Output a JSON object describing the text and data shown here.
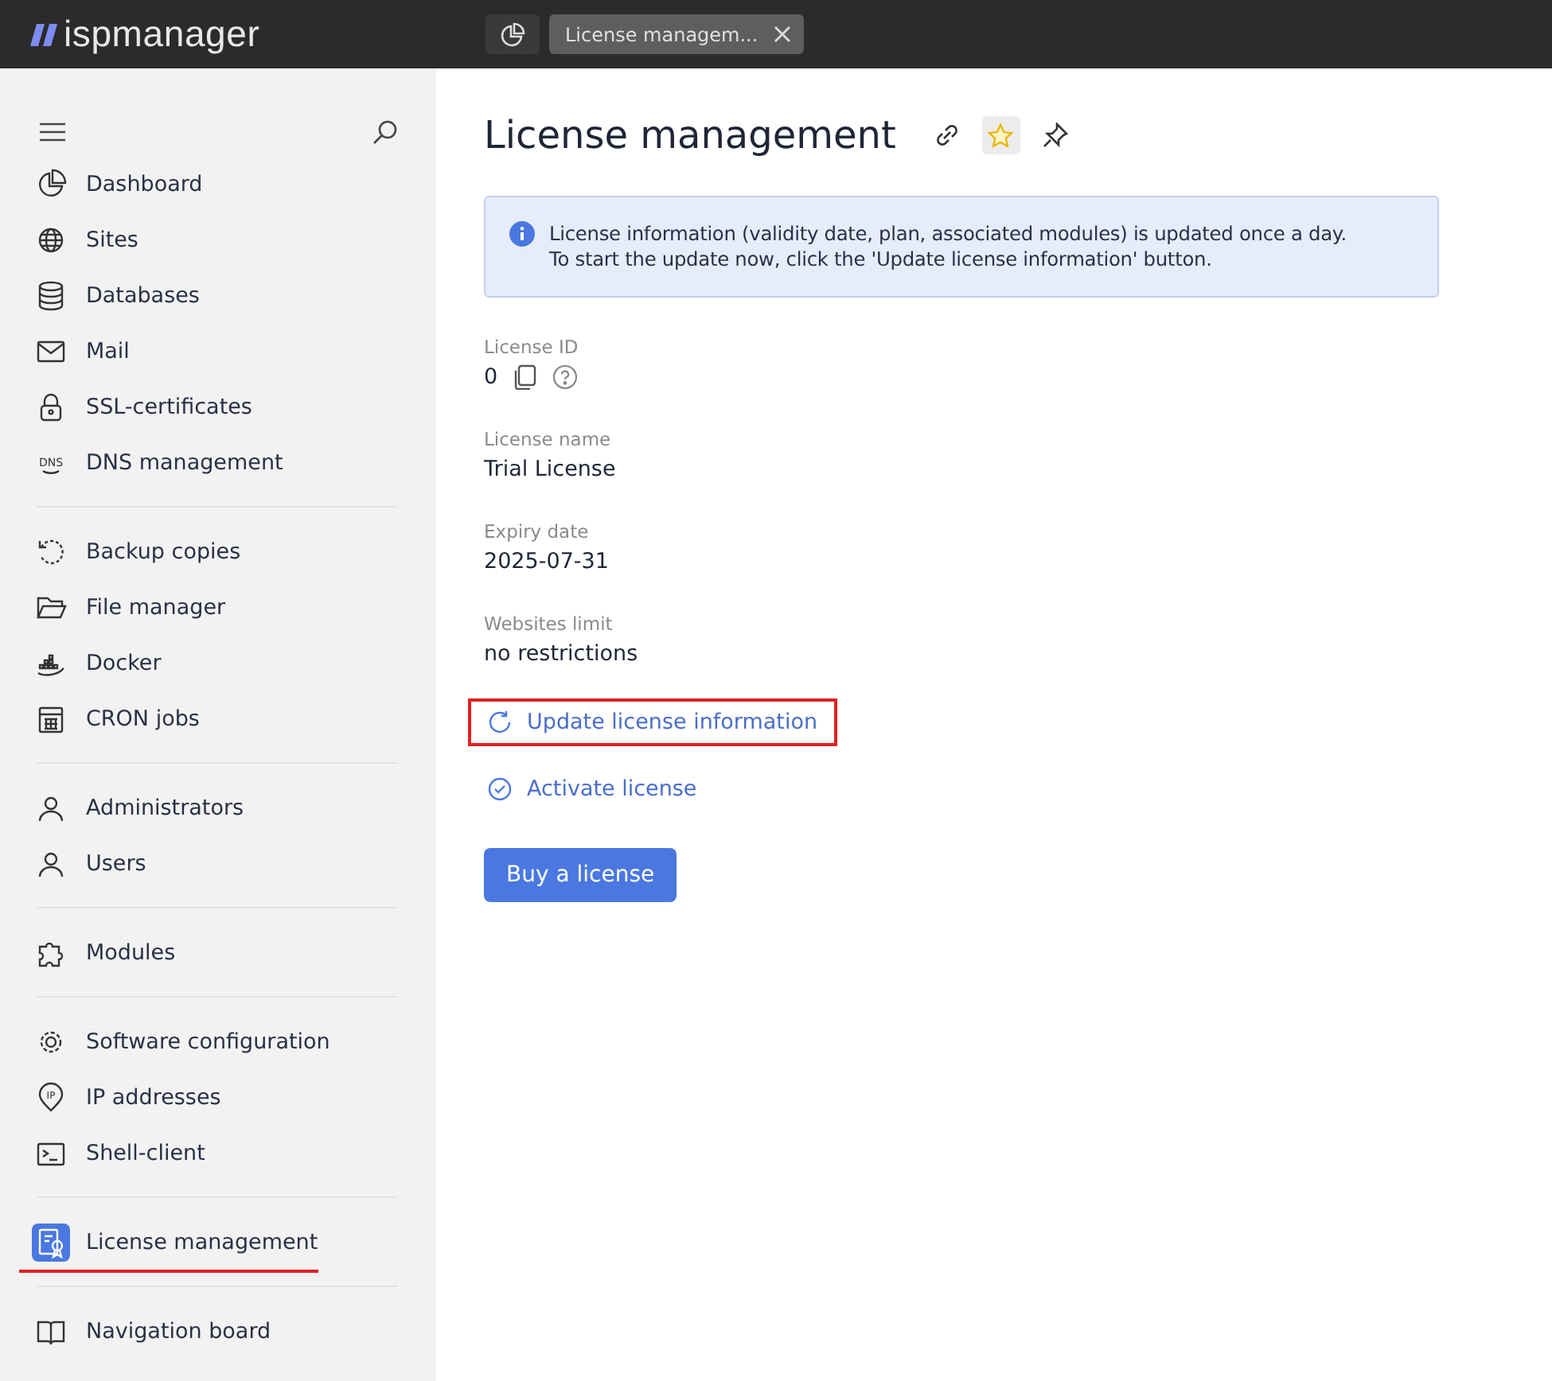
{
  "header": {
    "logo": "ispmanager",
    "tabs": [
      {
        "kind": "icon",
        "selected": false
      },
      {
        "kind": "page",
        "label": "License managem...",
        "selected": true
      }
    ]
  },
  "sidebar": {
    "groups": [
      [
        {
          "kind": "chart",
          "label": "Dashboard",
          "selected": false
        },
        {
          "kind": "globe",
          "label": "Sites",
          "selected": false
        },
        {
          "kind": "database",
          "label": "Databases",
          "selected": false
        },
        {
          "kind": "mail",
          "label": "Mail",
          "selected": false
        },
        {
          "kind": "lock",
          "label": "SSL-certificates",
          "selected": false
        },
        {
          "kind": "dns",
          "icon_label": "DNS",
          "label": "DNS management",
          "selected": false
        }
      ],
      [
        {
          "kind": "backup",
          "label": "Backup copies",
          "selected": false
        },
        {
          "kind": "folder",
          "label": "File manager",
          "selected": false
        },
        {
          "kind": "docker",
          "label": "Docker",
          "selected": false
        },
        {
          "kind": "calendar",
          "label": "CRON jobs",
          "selected": false
        }
      ],
      [
        {
          "kind": "admin",
          "label": "Administrators",
          "selected": false
        },
        {
          "kind": "user",
          "label": "Users",
          "selected": false
        }
      ],
      [
        {
          "kind": "puzzle",
          "label": "Modules",
          "selected": false
        }
      ],
      [
        {
          "kind": "gear",
          "label": "Software configuration",
          "selected": false
        },
        {
          "kind": "ip",
          "icon_label": "IP",
          "label": "IP addresses",
          "selected": false
        },
        {
          "kind": "terminal",
          "label": "Shell-client",
          "selected": false
        }
      ],
      [
        {
          "kind": "license",
          "label": "License management",
          "selected": true,
          "annotated": true
        }
      ],
      [
        {
          "kind": "book",
          "label": "Navigation board",
          "selected": false
        }
      ]
    ]
  },
  "page": {
    "title": "License management",
    "favorite": true,
    "notice": "License information (validity date, plan, associated modules) is updated once a day.\nTo start the update now, click the 'Update license information' button.",
    "fields": [
      {
        "label": "License ID",
        "value": "0",
        "copy": true,
        "help": true
      },
      {
        "label": "License name",
        "value": "Trial License"
      },
      {
        "label": "Expiry date",
        "value": "2025-07-31"
      },
      {
        "label": "Websites limit",
        "value": "no restrictions"
      }
    ],
    "actions": [
      {
        "kind": "refresh",
        "label": "Update license information",
        "annotated": true
      },
      {
        "kind": "check",
        "label": "Activate license",
        "annotated": false
      }
    ],
    "button": "Buy a license"
  }
}
